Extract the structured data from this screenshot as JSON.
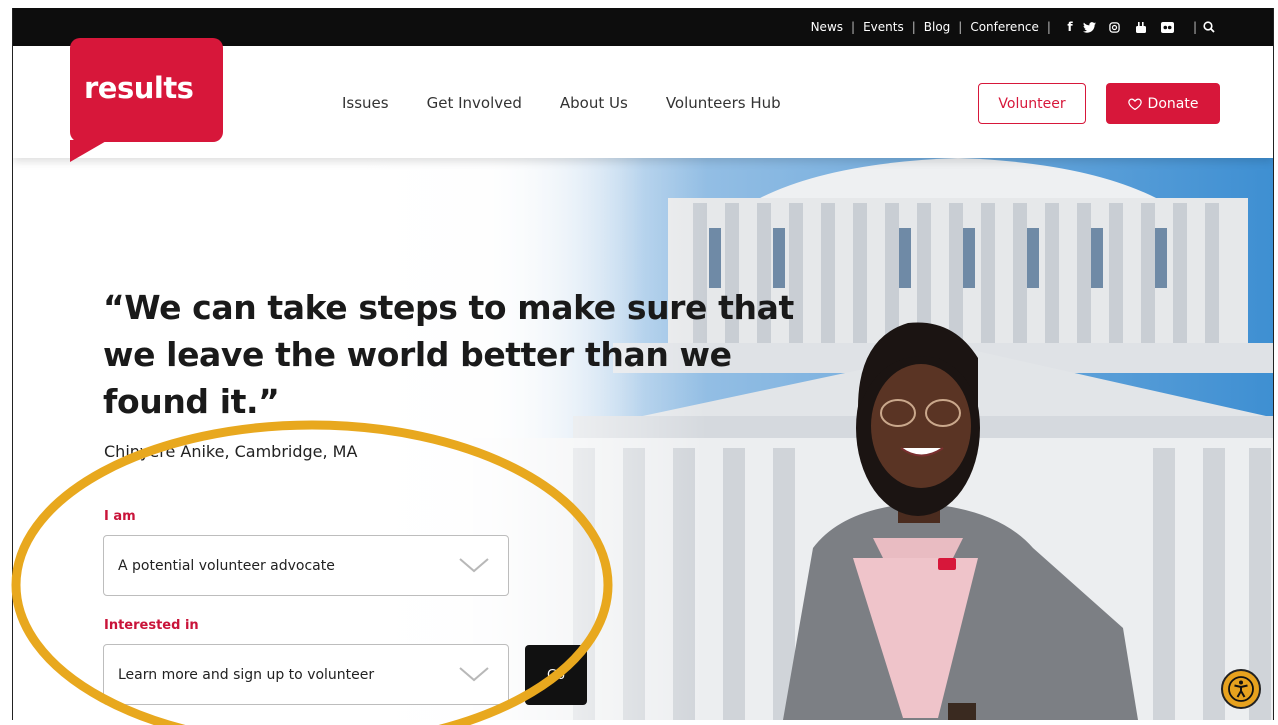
{
  "utility_bar": {
    "links": [
      "News",
      "Events",
      "Blog",
      "Conference"
    ],
    "social_icons": [
      "facebook-icon",
      "twitter-icon",
      "instagram-icon",
      "youtube-icon",
      "flickr-icon"
    ],
    "search_icon": "search-icon"
  },
  "header": {
    "logo_text": "results",
    "nav": [
      "Issues",
      "Get Involved",
      "About Us",
      "Volunteers Hub"
    ],
    "volunteer_label": "Volunteer",
    "donate_label": "Donate"
  },
  "hero": {
    "quote": "“We can take steps to make sure that we leave the world better than we found it.”",
    "attribution": "Chinyere Anike, Cambridge, MA"
  },
  "form": {
    "iam_label": "I am",
    "iam_value": "A potential volunteer advocate",
    "interested_label": "Interested in",
    "interested_value": "Learn more and sign up to volunteer",
    "go_label": "Go"
  },
  "colors": {
    "brand_red": "#d7173a",
    "highlight_ellipse": "#e8a81e",
    "utility_bar": "#0d0d0d"
  }
}
